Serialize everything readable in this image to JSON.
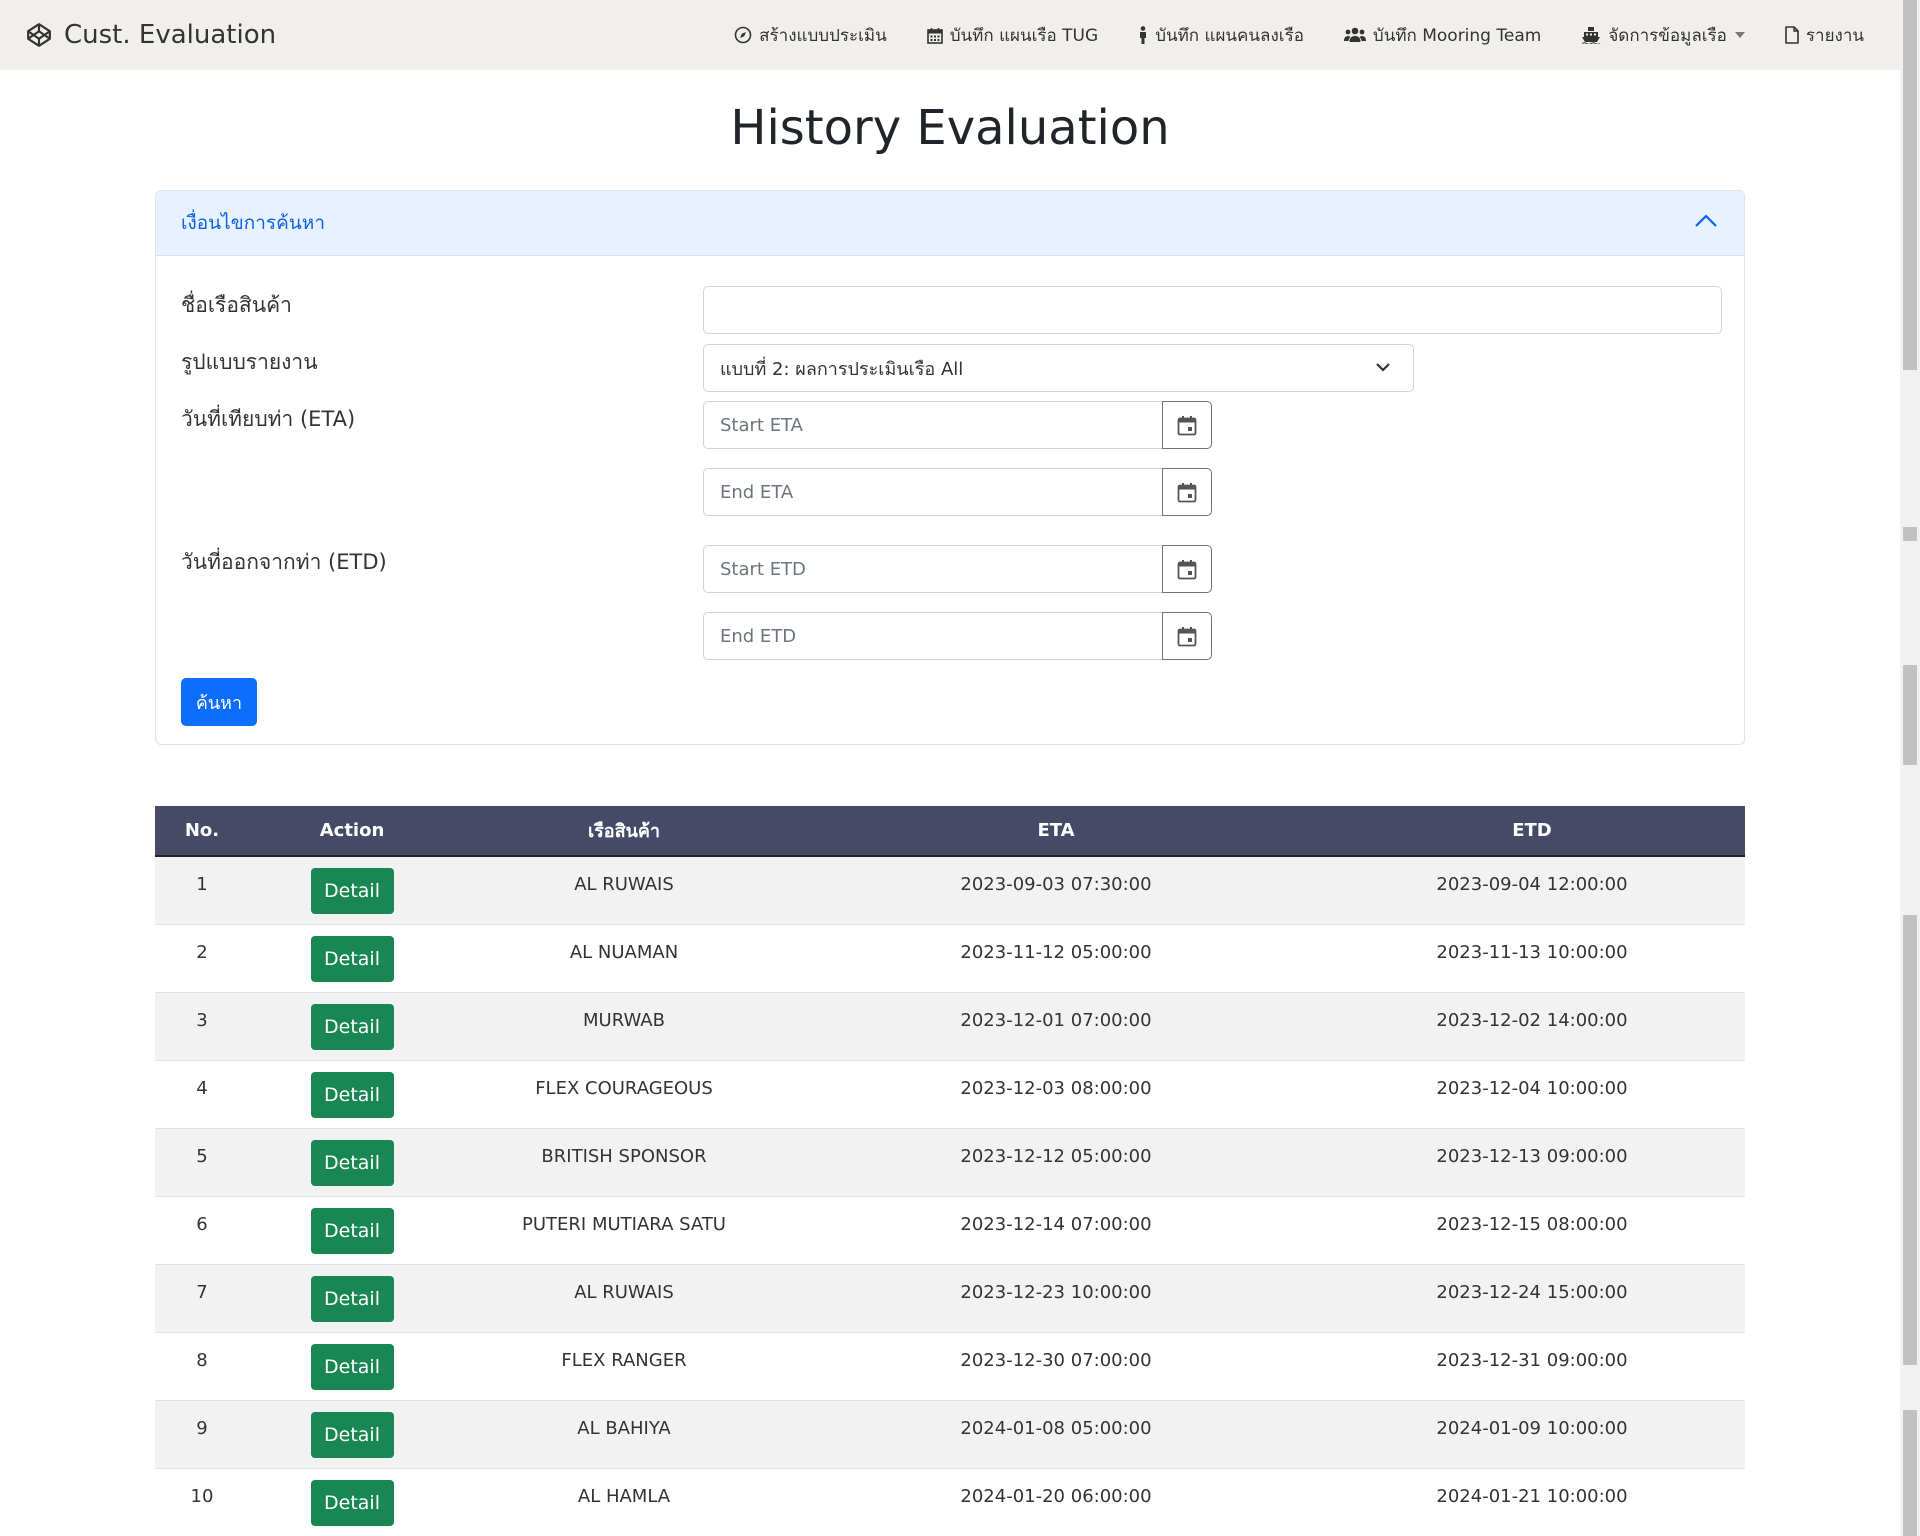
{
  "brand": "Cust. Evaluation",
  "nav": [
    {
      "label": "สร้างแบบประเมิน",
      "icon": "compass-icon"
    },
    {
      "label": "บันทึก แผนเรือ TUG",
      "icon": "calendar-icon"
    },
    {
      "label": "บันทึก แผนคนลงเรือ",
      "icon": "person-icon"
    },
    {
      "label": "บันทึก Mooring Team",
      "icon": "users-icon"
    },
    {
      "label": "จัดการข้อมูลเรือ",
      "icon": "ship-icon"
    },
    {
      "label": "รายงาน",
      "icon": "file-icon"
    }
  ],
  "page_title": "History Evaluation",
  "search": {
    "header": "เงื่อนไขการค้นหา",
    "ship_name_label": "ชื่อเรือสินค้า",
    "ship_name_value": "",
    "report_type_label": "รูปแบบรายงาน",
    "report_type_value": "แบบที่ 2: ผลการประเมินเรือ All",
    "eta_label": "วันที่เทียบท่า (ETA)",
    "start_eta_placeholder": "Start ETA",
    "end_eta_placeholder": "End ETA",
    "etd_label": "วันที่ออกจากท่า (ETD)",
    "start_etd_placeholder": "Start ETD",
    "end_etd_placeholder": "End ETD",
    "search_button": "ค้นหา"
  },
  "table": {
    "headers": [
      "No.",
      "Action",
      "เรือสินค้า",
      "ETA",
      "ETD"
    ],
    "detail_label": "Detail",
    "rows": [
      {
        "no": "1",
        "ship": "AL RUWAIS",
        "eta": "2023-09-03 07:30:00",
        "etd": "2023-09-04 12:00:00"
      },
      {
        "no": "2",
        "ship": "AL NUAMAN",
        "eta": "2023-11-12 05:00:00",
        "etd": "2023-11-13 10:00:00"
      },
      {
        "no": "3",
        "ship": "MURWAB",
        "eta": "2023-12-01 07:00:00",
        "etd": "2023-12-02 14:00:00"
      },
      {
        "no": "4",
        "ship": "FLEX COURAGEOUS",
        "eta": "2023-12-03 08:00:00",
        "etd": "2023-12-04 10:00:00"
      },
      {
        "no": "5",
        "ship": "BRITISH SPONSOR",
        "eta": "2023-12-12 05:00:00",
        "etd": "2023-12-13 09:00:00"
      },
      {
        "no": "6",
        "ship": "PUTERI MUTIARA SATU",
        "eta": "2023-12-14 07:00:00",
        "etd": "2023-12-15 08:00:00"
      },
      {
        "no": "7",
        "ship": "AL RUWAIS",
        "eta": "2023-12-23 10:00:00",
        "etd": "2023-12-24 15:00:00"
      },
      {
        "no": "8",
        "ship": "FLEX RANGER",
        "eta": "2023-12-30 07:00:00",
        "etd": "2023-12-31 09:00:00"
      },
      {
        "no": "9",
        "ship": "AL BAHIYA",
        "eta": "2024-01-08 05:00:00",
        "etd": "2024-01-09 10:00:00"
      },
      {
        "no": "10",
        "ship": "AL HAMLA",
        "eta": "2024-01-20 06:00:00",
        "etd": "2024-01-21 10:00:00"
      }
    ]
  }
}
